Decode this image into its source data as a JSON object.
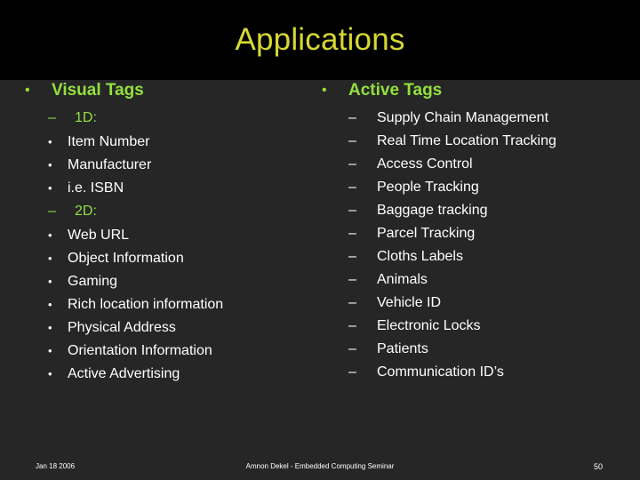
{
  "slide": {
    "title": "Applications",
    "page_number": "50",
    "colors": {
      "title_text": "#d7d831",
      "heading_green": "#93e03e",
      "body_text": "#ffffff",
      "title_band_bg": "#000000",
      "body_bg": "#262626"
    }
  },
  "columns": {
    "left": {
      "heading": {
        "bullet": "•",
        "label": "Visual Tags"
      },
      "groups": [
        {
          "bullet": "–",
          "label": "1D:",
          "items": [
            {
              "bullet": "•",
              "label": "Item Number"
            },
            {
              "bullet": "•",
              "label": "Manufacturer"
            },
            {
              "bullet": "•",
              "label": "i.e. ISBN"
            }
          ]
        },
        {
          "bullet": "–",
          "label": "2D:",
          "items": [
            {
              "bullet": "•",
              "label": "Web URL"
            },
            {
              "bullet": "•",
              "label": "Object Information"
            },
            {
              "bullet": "•",
              "label": "Gaming"
            },
            {
              "bullet": "•",
              "label": "Rich location information"
            },
            {
              "bullet": "•",
              "label": "Physical Address"
            },
            {
              "bullet": "•",
              "label": "Orientation Information"
            },
            {
              "bullet": "•",
              "label": "Active Advertising"
            }
          ]
        }
      ]
    },
    "right": {
      "heading": {
        "bullet": "•",
        "label": "Active Tags"
      },
      "items": [
        {
          "bullet": "–",
          "label": "Supply Chain Management"
        },
        {
          "bullet": "–",
          "label": "Real Time Location Tracking"
        },
        {
          "bullet": "–",
          "label": "Access Control"
        },
        {
          "bullet": "–",
          "label": "People Tracking"
        },
        {
          "bullet": "–",
          "label": "Baggage tracking"
        },
        {
          "bullet": "–",
          "label": "Parcel Tracking"
        },
        {
          "bullet": "–",
          "label": "Cloths Labels"
        },
        {
          "bullet": "–",
          "label": "Animals"
        },
        {
          "bullet": "–",
          "label": "Vehicle ID"
        },
        {
          "bullet": "–",
          "label": "Electronic Locks"
        },
        {
          "bullet": "–",
          "label": "Patients"
        },
        {
          "bullet": "–",
          "label": "Communication ID’s"
        }
      ]
    }
  },
  "footer": {
    "date": "Jan 18 2006",
    "center": "Amnon Dekel - Embedded Computing Seminar",
    "page": "50"
  }
}
